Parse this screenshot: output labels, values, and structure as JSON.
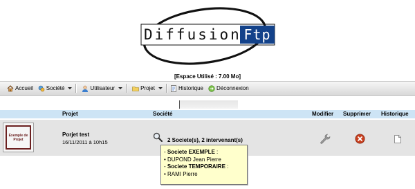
{
  "logo": {
    "word": "Diffusion",
    "box_word": "Ftp"
  },
  "space_used": "[Espace Utilisé : 7.00 Mo]",
  "toolbar": {
    "accueil": "Accueil",
    "societe": "Société",
    "utilisateur": "Utilisateur",
    "projet": "Projet",
    "historique": "Historique",
    "deconnexion": "Déconnexion"
  },
  "search": {
    "value": ""
  },
  "table": {
    "headers": {
      "projet": "Projet",
      "societe": "Société",
      "modifier": "Modifier",
      "supprimer": "Supprimer",
      "historique": "Historique"
    },
    "rows": [
      {
        "thumbnail_text": "Exemple de Projet",
        "name": "Porjet test",
        "date": "16/11/2011 à 10h15",
        "societe_summary": "2 Societe(s), 2 intervenant(s)"
      }
    ]
  },
  "tooltip": {
    "companies": [
      {
        "prefix": "- ",
        "name": "Societe EXEMPLE",
        "suffix": " :",
        "people": [
          "• DUPOND Jean Pierre"
        ]
      },
      {
        "prefix": "- ",
        "name": "Societe TEMPORAIRE",
        "suffix": " :",
        "people": [
          "• RAMI Pierre"
        ]
      }
    ]
  },
  "colors": {
    "header_bg": "#cde4f5",
    "row_bg": "#e4e4e4",
    "tooltip_bg": "#ffffcc",
    "logo_blue": "#13428a",
    "thumb_border": "#6b2020"
  }
}
